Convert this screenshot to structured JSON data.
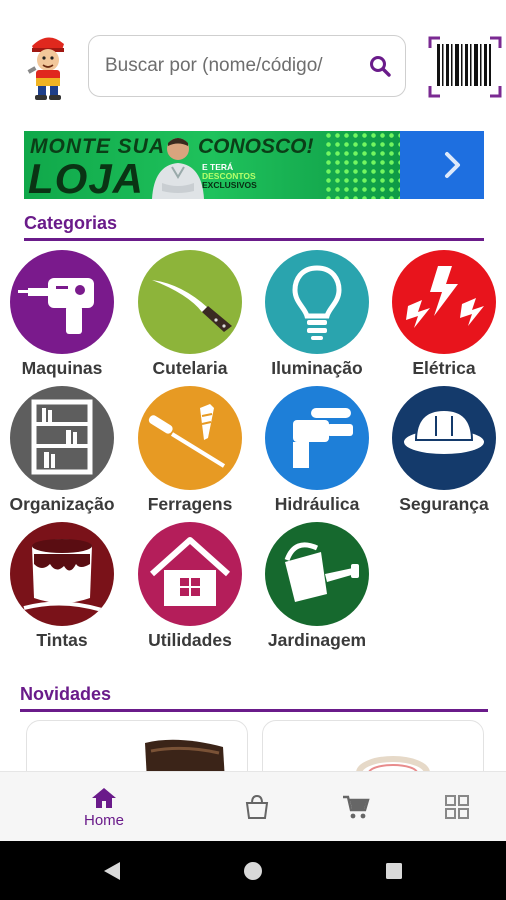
{
  "header": {
    "mascot_icon": "handyman-mascot-icon",
    "search": {
      "placeholder": "Buscar por (nome/código/",
      "icon": "search-icon"
    },
    "barcode_icon": "barcode-scanner-icon"
  },
  "banner": {
    "line1": "MONTE SUA",
    "line2": "LOJA",
    "line3": "CONOSCO!",
    "small1": "E TERÁ",
    "small2": "DESCONTOS",
    "small3": "EXCLUSIVOS",
    "next_icon": "chevron-right-icon"
  },
  "categories": {
    "title": "Categorias",
    "items": [
      {
        "label": "Maquinas",
        "icon": "drill-icon",
        "color": "#7a1a8c"
      },
      {
        "label": "Cutelaria",
        "icon": "knife-icon",
        "color": "#8db43a"
      },
      {
        "label": "Iluminação",
        "icon": "lightbulb-icon",
        "color": "#2aa4ae"
      },
      {
        "label": "Elétrica",
        "icon": "electricity-icon",
        "color": "#e8141c"
      },
      {
        "label": "Organização",
        "icon": "shelf-icon",
        "color": "#5e5e5e"
      },
      {
        "label": "Ferragens",
        "icon": "screwdriver-screw-icon",
        "color": "#e79a23"
      },
      {
        "label": "Hidráulica",
        "icon": "faucet-icon",
        "color": "#1e7fd8"
      },
      {
        "label": "Segurança",
        "icon": "safety-helmet-icon",
        "color": "#143a6b"
      },
      {
        "label": "Tintas",
        "icon": "paint-can-icon",
        "color": "#7a1219"
      },
      {
        "label": "Utilidades",
        "icon": "house-icon",
        "color": "#b41e5a"
      },
      {
        "label": "Jardinagem",
        "icon": "watering-can-icon",
        "color": "#16692e"
      }
    ]
  },
  "novidades": {
    "title": "Novidades"
  },
  "bottom_nav": {
    "home_label": "Home",
    "home_icon": "home-icon",
    "bag_icon": "shopping-bag-icon",
    "cart_icon": "cart-icon",
    "grid_icon": "grid-icon",
    "active_color": "#6a1b8a"
  },
  "system_nav": {
    "back": "back-icon",
    "home": "home-circle-icon",
    "recents": "recents-icon"
  }
}
